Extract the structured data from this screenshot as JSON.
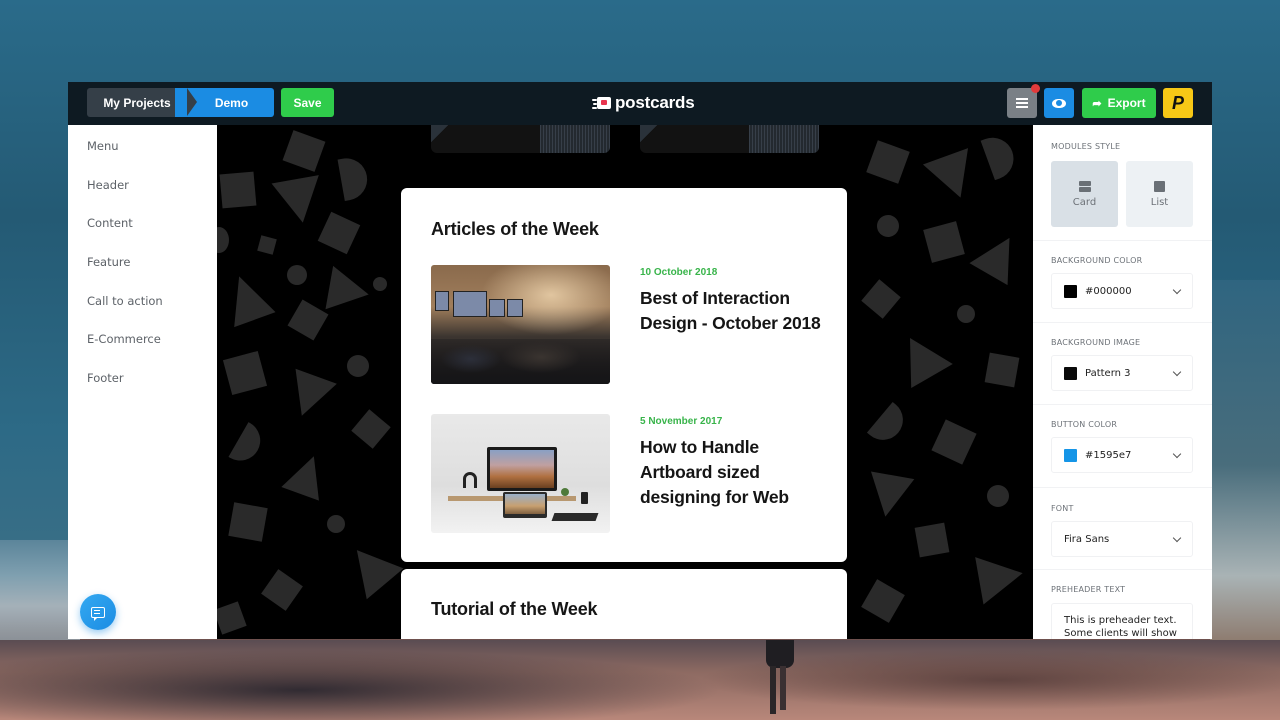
{
  "toolbar": {
    "breadcrumb": [
      {
        "label": "My Projects"
      },
      {
        "label": "Demo"
      }
    ],
    "save_label": "Save",
    "logo_text": "postcards",
    "menu_icon": "hamburger-icon",
    "notification_dot": true,
    "preview_icon": "eye-icon",
    "export_label": "Export",
    "export_icon": "share-arrow-icon",
    "brand_letter": "P"
  },
  "sidebar_left": {
    "items": [
      {
        "label": "Menu"
      },
      {
        "label": "Header"
      },
      {
        "label": "Content"
      },
      {
        "label": "Feature"
      },
      {
        "label": "Call to action"
      },
      {
        "label": "E-Commerce"
      },
      {
        "label": "Footer"
      }
    ],
    "chat_icon": "chat-icon"
  },
  "canvas": {
    "articles_card": {
      "title": "Articles of the Week",
      "articles": [
        {
          "date": "10 October 2018",
          "title": "Best of Interaction Design - October 2018",
          "image": "event-audience-photo"
        },
        {
          "date": "5 November 2017",
          "title": "How to Handle Artboard sized designing for Web",
          "image": "desk-setup-photo"
        }
      ]
    },
    "tutorial_card": {
      "title": "Tutorial of the Week"
    }
  },
  "sidebar_right": {
    "modules_style": {
      "label": "MODULES STYLE",
      "options": [
        {
          "label": "Card",
          "selected": true
        },
        {
          "label": "List",
          "selected": false
        }
      ]
    },
    "background_color": {
      "label": "BACKGROUND COLOR",
      "value": "#000000",
      "swatch": "#000000"
    },
    "background_image": {
      "label": "BACKGROUND IMAGE",
      "value": "Pattern 3",
      "swatch": "#0a0a0a"
    },
    "button_color": {
      "label": "BUTTON COLOR",
      "value": "#1595e7",
      "swatch": "#1595e7"
    },
    "font": {
      "label": "FONT",
      "value": "Fira Sans"
    },
    "preheader": {
      "label": "PREHEADER TEXT",
      "value": "This is preheader text. Some clients will show"
    }
  },
  "colors": {
    "accent_blue": "#1b8ce3",
    "accent_green": "#2fcc4b",
    "brand_yellow": "#f7c816",
    "date_green": "#38b44a",
    "topbar": "#0e1a22"
  }
}
